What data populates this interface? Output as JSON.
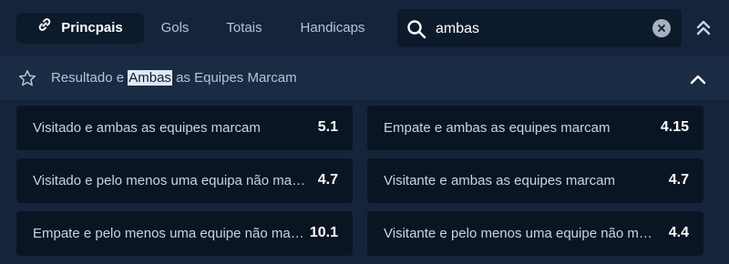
{
  "tabs": [
    {
      "label": "Princpais",
      "icon": "link-icon",
      "active": true
    },
    {
      "label": "Gols",
      "active": false
    },
    {
      "label": "Totais",
      "active": false
    },
    {
      "label": "Handicaps",
      "active": false
    }
  ],
  "search": {
    "value": "ambas",
    "icon": "search-icon",
    "clear_icon": "close-icon"
  },
  "section": {
    "title_prefix": "Resultado e ",
    "title_highlight": "Ambas",
    "title_suffix": " as Equipes Marcam",
    "icon": "star-icon"
  },
  "odds": [
    {
      "label": "Visitado e ambas as equipes marcam",
      "value": "5.1"
    },
    {
      "label": "Empate e ambas as equipes marcam",
      "value": "4.15"
    },
    {
      "label": "Visitado e pelo menos uma equipa não marca",
      "value": "4.7"
    },
    {
      "label": "Visitante e ambas as equipes marcam",
      "value": "4.7"
    },
    {
      "label": "Empate e pelo menos uma equipe não marca",
      "value": "10.1"
    },
    {
      "label": "Visitante e pelo menos uma equipe não marca",
      "value": "4.4"
    }
  ],
  "colors": {
    "accent_text": "#ffffff",
    "panel": "#0a1524",
    "background": "#15243a"
  }
}
